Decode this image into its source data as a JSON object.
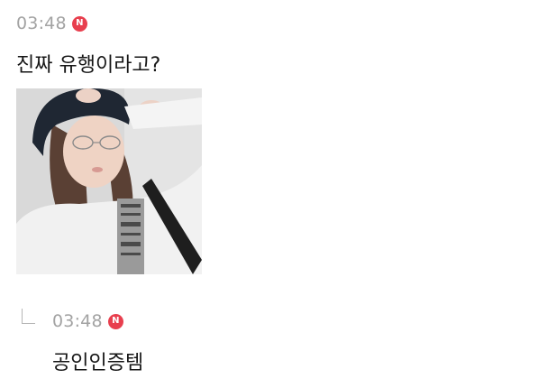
{
  "post": {
    "time": "03:48",
    "badge": "N",
    "text": "진짜 유행이라고?",
    "photo_description_icon": "photo-image"
  },
  "reply": {
    "time": "03:48",
    "badge": "N",
    "text": "공인인증템"
  },
  "colors": {
    "badge": "#e83f4e",
    "time": "#a3a3a3",
    "text": "#161616",
    "reply_arrow": "#b6b6b6"
  }
}
